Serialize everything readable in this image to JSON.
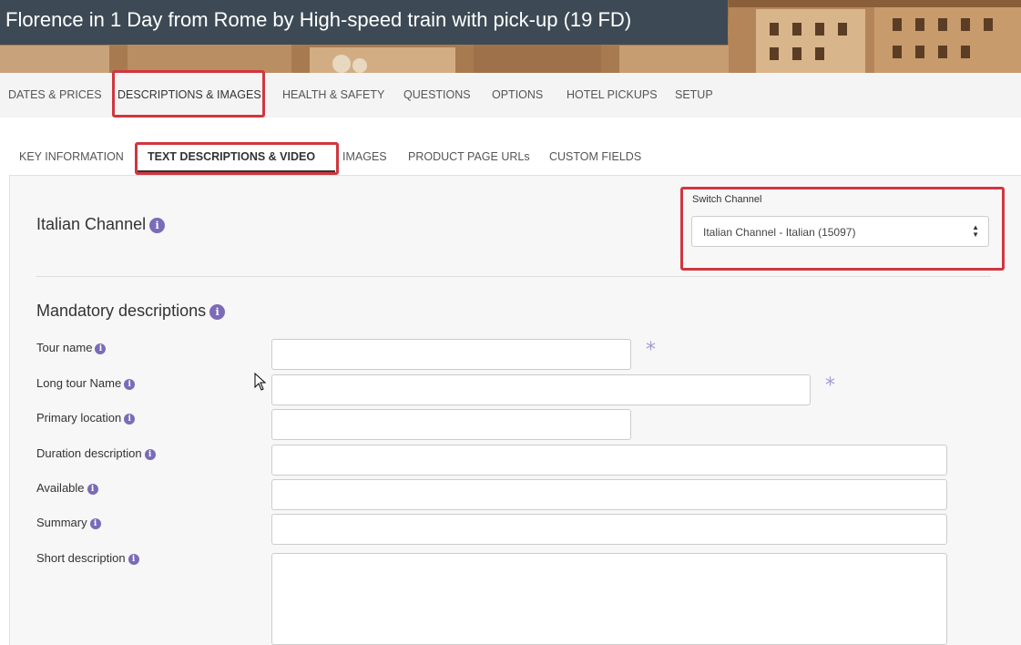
{
  "banner": {
    "title": "Florence in 1 Day from Rome by High-speed train with pick-up (19 FD)"
  },
  "main_tabs": [
    {
      "label": "DATES & PRICES",
      "active": false
    },
    {
      "label": "DESCRIPTIONS & IMAGES",
      "active": true
    },
    {
      "label": "HEALTH & SAFETY",
      "active": false
    },
    {
      "label": "QUESTIONS",
      "active": false
    },
    {
      "label": "OPTIONS",
      "active": false
    },
    {
      "label": "HOTEL PICKUPS",
      "active": false
    },
    {
      "label": "SETUP",
      "active": false
    }
  ],
  "sub_tabs": [
    {
      "label": "KEY INFORMATION",
      "active": false
    },
    {
      "label": "TEXT DESCRIPTIONS & VIDEO",
      "active": true
    },
    {
      "label": "IMAGES",
      "active": false
    },
    {
      "label": "PRODUCT PAGE URLs",
      "active": false
    },
    {
      "label": "CUSTOM FIELDS",
      "active": false
    }
  ],
  "channel": {
    "title": "Italian Channel",
    "switch_label": "Switch Channel",
    "selected": "Italian Channel - Italian (15097)"
  },
  "mandatory": {
    "title": "Mandatory descriptions",
    "required_mark": "*",
    "fields": [
      {
        "label": "Tour name",
        "value": "",
        "required": true
      },
      {
        "label": "Long tour Name",
        "value": "",
        "required": true
      },
      {
        "label": "Primary location",
        "value": "",
        "required": false
      },
      {
        "label": "Duration description",
        "value": "",
        "required": false
      },
      {
        "label": "Available",
        "value": "",
        "required": false
      },
      {
        "label": "Summary",
        "value": "",
        "required": false
      },
      {
        "label": "Short description",
        "value": "",
        "required": false
      }
    ]
  },
  "icons": {
    "info": "info-icon",
    "sort": "sort-arrows-icon",
    "cursor": "mouse-pointer-icon"
  },
  "colors": {
    "title_bar": "#3d4a55",
    "accent": "#7b6bb8",
    "required": "#a59bd0",
    "highlight": "#d0363f"
  }
}
